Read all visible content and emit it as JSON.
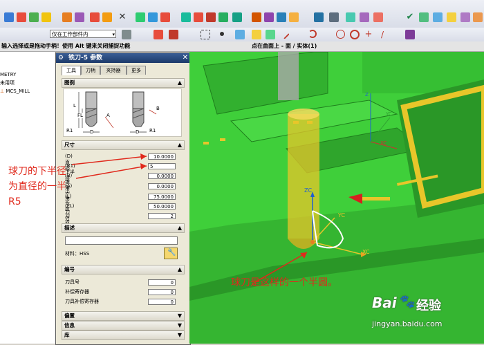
{
  "toolbar": {
    "filter_select": "仅在工作部件内"
  },
  "status": {
    "left_hint": "输入选择或是拖动手柄！使用 Alt 键来关闭捕捉功能",
    "right_hint": "点在曲面上 - 面 / 实体(1)"
  },
  "navigator": {
    "items": [
      "METRY",
      "未用项",
      "MCS_MILL"
    ]
  },
  "dialog": {
    "title": "铣刀-5 参数",
    "tabs": [
      "工具",
      "刀柄",
      "夹持器",
      "更多"
    ],
    "sections": {
      "diagram": "图例",
      "dimensions": "尺寸",
      "description": "描述",
      "numbering": "编号",
      "offset": "偏置",
      "info": "信息",
      "library": "库"
    },
    "diagram_labels": {
      "left": [
        "L",
        "FL",
        "A",
        "R1",
        "D"
      ],
      "right": [
        "B",
        "R1",
        "D"
      ]
    },
    "fields": [
      {
        "label": "(D) 直径",
        "value": "10.0000"
      },
      {
        "label": "(R1) 下半径",
        "value": "5"
      },
      {
        "label": "(B) 锥角",
        "value": "0.0000"
      },
      {
        "label": "(A) 尖角",
        "value": "0.0000"
      },
      {
        "label": "(L) 长度",
        "value": "75.0000"
      },
      {
        "label": "(FL) 刀刃长度",
        "value": "50.0000"
      },
      {
        "label": "刀刃",
        "value": "2"
      }
    ],
    "material_label": "材料：HSS",
    "number_fields": [
      {
        "label": "刀具号",
        "value": "0"
      },
      {
        "label": "补偿寄存器",
        "value": "0"
      },
      {
        "label": "刀具补偿寄存器",
        "value": "0"
      }
    ]
  },
  "annotations": {
    "left_line1": "球刀的下半径",
    "left_line2": "为直径的一半",
    "left_line3": "R5",
    "bottom": "球刀是这样的一个半圆。"
  },
  "viewport": {
    "axis_labels": {
      "zc": "ZC",
      "yc": "YC",
      "xc": "XC",
      "z_small": "Z",
      "y_small": "YC",
      "x_small": "XC"
    }
  },
  "watermark": {
    "brand_pre": "Bai",
    "brand_post": "经验",
    "url": "jingyan.baidu.com"
  },
  "colors": {
    "model_green": "#3fcf3a",
    "tool_yellow": "#e8c62a",
    "annotation_red": "#e0291c",
    "title_blue": "#1d3a6a"
  }
}
